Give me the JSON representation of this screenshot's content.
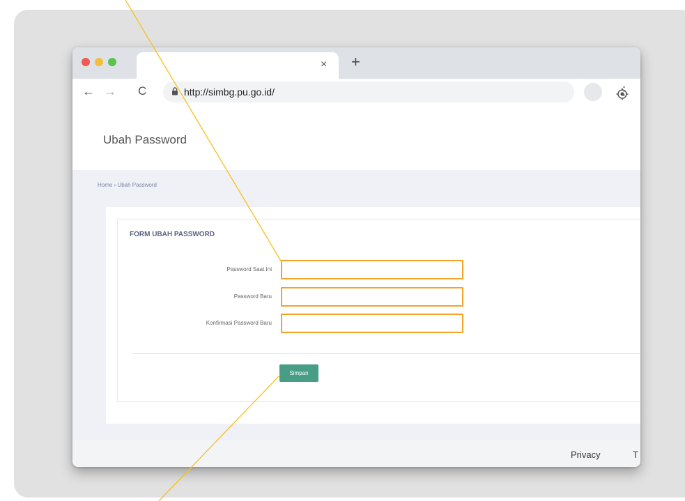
{
  "browser": {
    "tab_close": "×",
    "new_tab": "+",
    "back": "←",
    "forward": "→",
    "reload": "C",
    "url": "http://simbg.pu.go.id/",
    "star": "☆",
    "menu": "⋮"
  },
  "page": {
    "title": "Ubah Password",
    "breadcrumb": "Home › Ubah Password"
  },
  "form": {
    "title": "FORM UBAH PASSWORD",
    "fields": [
      {
        "label": "Password Saat Ini",
        "value": ""
      },
      {
        "label": "Password Baru",
        "value": ""
      },
      {
        "label": "Konfirmasi Password Baru",
        "value": ""
      }
    ],
    "save_label": "Simpan"
  },
  "footer": {
    "privacy": "Privacy",
    "truncated": "T"
  },
  "colors": {
    "highlight": "#f2a428",
    "button": "#479d86",
    "callout_line": "#f4c21a"
  }
}
